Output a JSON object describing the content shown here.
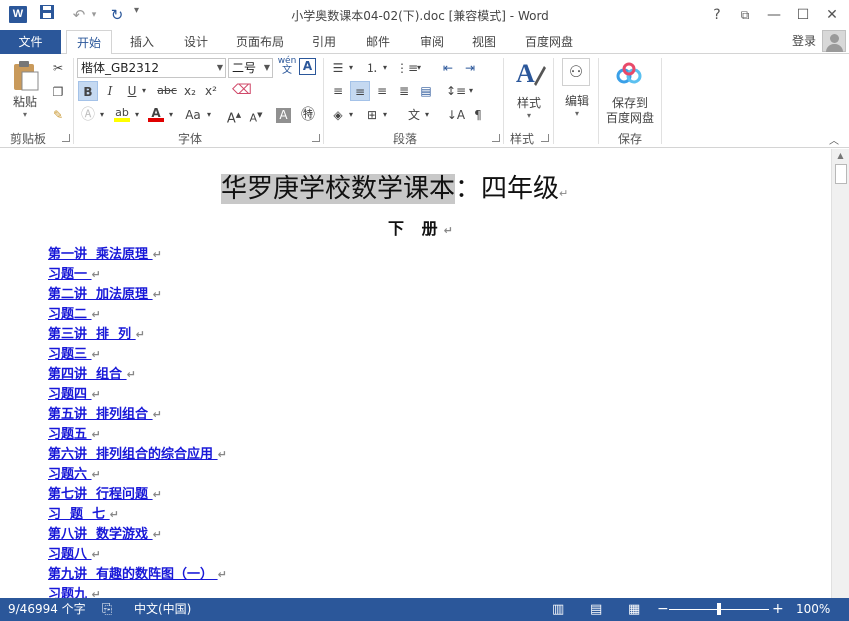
{
  "titlebar": {
    "app_icon": "word-logo-icon",
    "app_icon_letter": "W",
    "title": "小学奥数课本04-02(下).doc [兼容模式] - Word",
    "help": "?",
    "ribbon_display": "⧉",
    "minimize": "—",
    "maximize": "☐",
    "close": "✕"
  },
  "tabs": {
    "file": "文件",
    "items": [
      "开始",
      "插入",
      "设计",
      "页面布局",
      "引用",
      "邮件",
      "审阅",
      "视图",
      "百度网盘"
    ],
    "active_index": 0,
    "login": "登录"
  },
  "ribbon": {
    "clipboard": {
      "paste": "粘贴",
      "label": "剪贴板"
    },
    "font": {
      "name": "楷体_GB2312",
      "size": "二号",
      "phonetic": "wén",
      "phonetic_sub": "文",
      "bold": "B",
      "italic": "I",
      "underline": "U",
      "strike": "abc",
      "sub": "x₂",
      "sup": "x²",
      "aa": "Aa",
      "label": "字体"
    },
    "paragraph": {
      "label": "段落"
    },
    "styles": {
      "button": "样式",
      "label": "样式"
    },
    "editing": {
      "button": "编辑"
    },
    "save": {
      "line1": "保存到",
      "line2": "百度网盘",
      "label": "保存"
    }
  },
  "document": {
    "title_highlighted": "华罗庚学校数学课本",
    "title_rest": "：四年级",
    "paragraph_mark": "↵",
    "subtitle": "下 册",
    "toc": [
      "第一讲  乘法原理 ",
      "习题一 ",
      "第二讲  加法原理 ",
      "习题二 ",
      "第三讲  排  列 ",
      "习题三 ",
      "第四讲  组合 ",
      "习题四 ",
      "第五讲  排列组合 ",
      "习题五 ",
      "第六讲  排列组合的综合应用 ",
      "习题六 ",
      "第七讲  行程问题 ",
      "习  题  七 ",
      "第八讲  数学游戏 ",
      "习题八 ",
      "第九讲  有趣的数阵图（一） ",
      "习题九 "
    ]
  },
  "statusbar": {
    "word_count": "9/46994 个字",
    "language": "中文(中国)",
    "zoom_minus": "−",
    "zoom_plus": "+",
    "zoom": "100%",
    "zoom_fraction": 0.5
  },
  "colors": {
    "accent": "#2b579a",
    "toc_link": "#1818d8",
    "highlight": "#c8c8c8"
  }
}
